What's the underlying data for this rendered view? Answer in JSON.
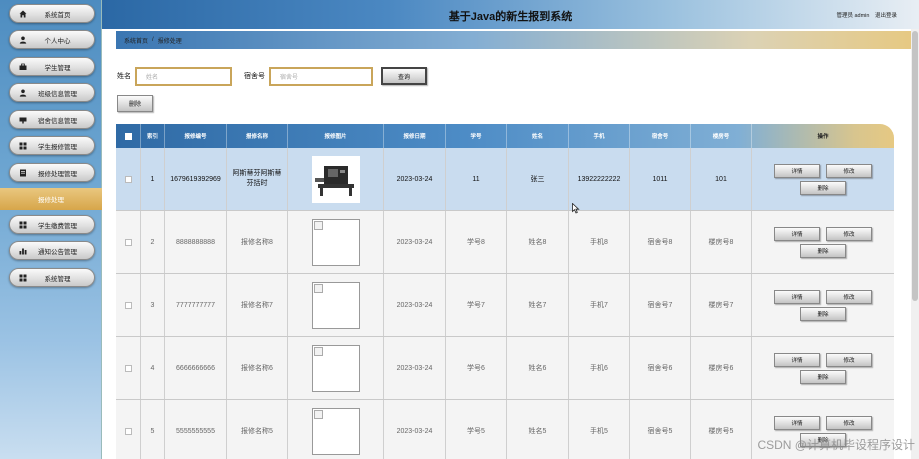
{
  "header": {
    "title": "基于Java的新生报到系统",
    "user_label": "管理员 admin",
    "logout": "退出登录"
  },
  "sidebar": {
    "items": [
      {
        "label": "系统首页",
        "icon": "home-icon"
      },
      {
        "label": "个人中心",
        "icon": "person-icon"
      },
      {
        "label": "学生管理",
        "icon": "briefcase-icon"
      },
      {
        "label": "班级信息管理",
        "icon": "person-icon"
      },
      {
        "label": "宿舍信息管理",
        "icon": "bed-icon"
      },
      {
        "label": "学生报修管理",
        "icon": "grid-icon"
      },
      {
        "label": "报修处理管理",
        "icon": "document-icon"
      },
      {
        "label": "学生缴费管理",
        "icon": "grid-icon"
      },
      {
        "label": "通知公告管理",
        "icon": "bar-chart-icon"
      },
      {
        "label": "系统管理",
        "icon": "grid-icon"
      }
    ],
    "active_sub": "报修处理"
  },
  "breadcrumb": {
    "home": "系统首页",
    "sep": "/",
    "current": "报修处理"
  },
  "search": {
    "name_label": "姓名",
    "name_placeholder": "姓名",
    "dorm_label": "宿舍号",
    "dorm_placeholder": "宿舍号",
    "query": "查询"
  },
  "delete_label": "删除",
  "table": {
    "headers": [
      "索引",
      "报修编号",
      "报修名称",
      "报修图片",
      "报修日期",
      "学号",
      "姓名",
      "手机",
      "宿舍号",
      "楼房号",
      "操作"
    ],
    "rows": [
      {
        "index": "1",
        "code": "1679619392969",
        "name": "阿斯蒂芬阿斯蒂芬括时",
        "img": "machine",
        "date": "2023-03-24",
        "sid": "11",
        "sname": "张三",
        "phone": "13922222222",
        "dorm": "1011",
        "building": "101"
      },
      {
        "index": "2",
        "code": "8888888888",
        "name": "报修名称8",
        "img": "broken",
        "date": "2023-03-24",
        "sid": "学号8",
        "sname": "姓名8",
        "phone": "手机8",
        "dorm": "宿舍号8",
        "building": "楼房号8"
      },
      {
        "index": "3",
        "code": "7777777777",
        "name": "报修名称7",
        "img": "broken",
        "date": "2023-03-24",
        "sid": "学号7",
        "sname": "姓名7",
        "phone": "手机7",
        "dorm": "宿舍号7",
        "building": "楼房号7"
      },
      {
        "index": "4",
        "code": "6666666666",
        "name": "报修名称6",
        "img": "broken",
        "date": "2023-03-24",
        "sid": "学号6",
        "sname": "姓名6",
        "phone": "手机6",
        "dorm": "宿舍号6",
        "building": "楼房号6"
      },
      {
        "index": "5",
        "code": "5555555555",
        "name": "报修名称5",
        "img": "broken",
        "date": "2023-03-24",
        "sid": "学号5",
        "sname": "姓名5",
        "phone": "手机5",
        "dorm": "宿舍号5",
        "building": "楼房号5"
      }
    ],
    "actions": {
      "detail": "详情",
      "edit": "修改",
      "delete": "删除"
    }
  },
  "watermark": "CSDN @计算机毕设程序设计"
}
